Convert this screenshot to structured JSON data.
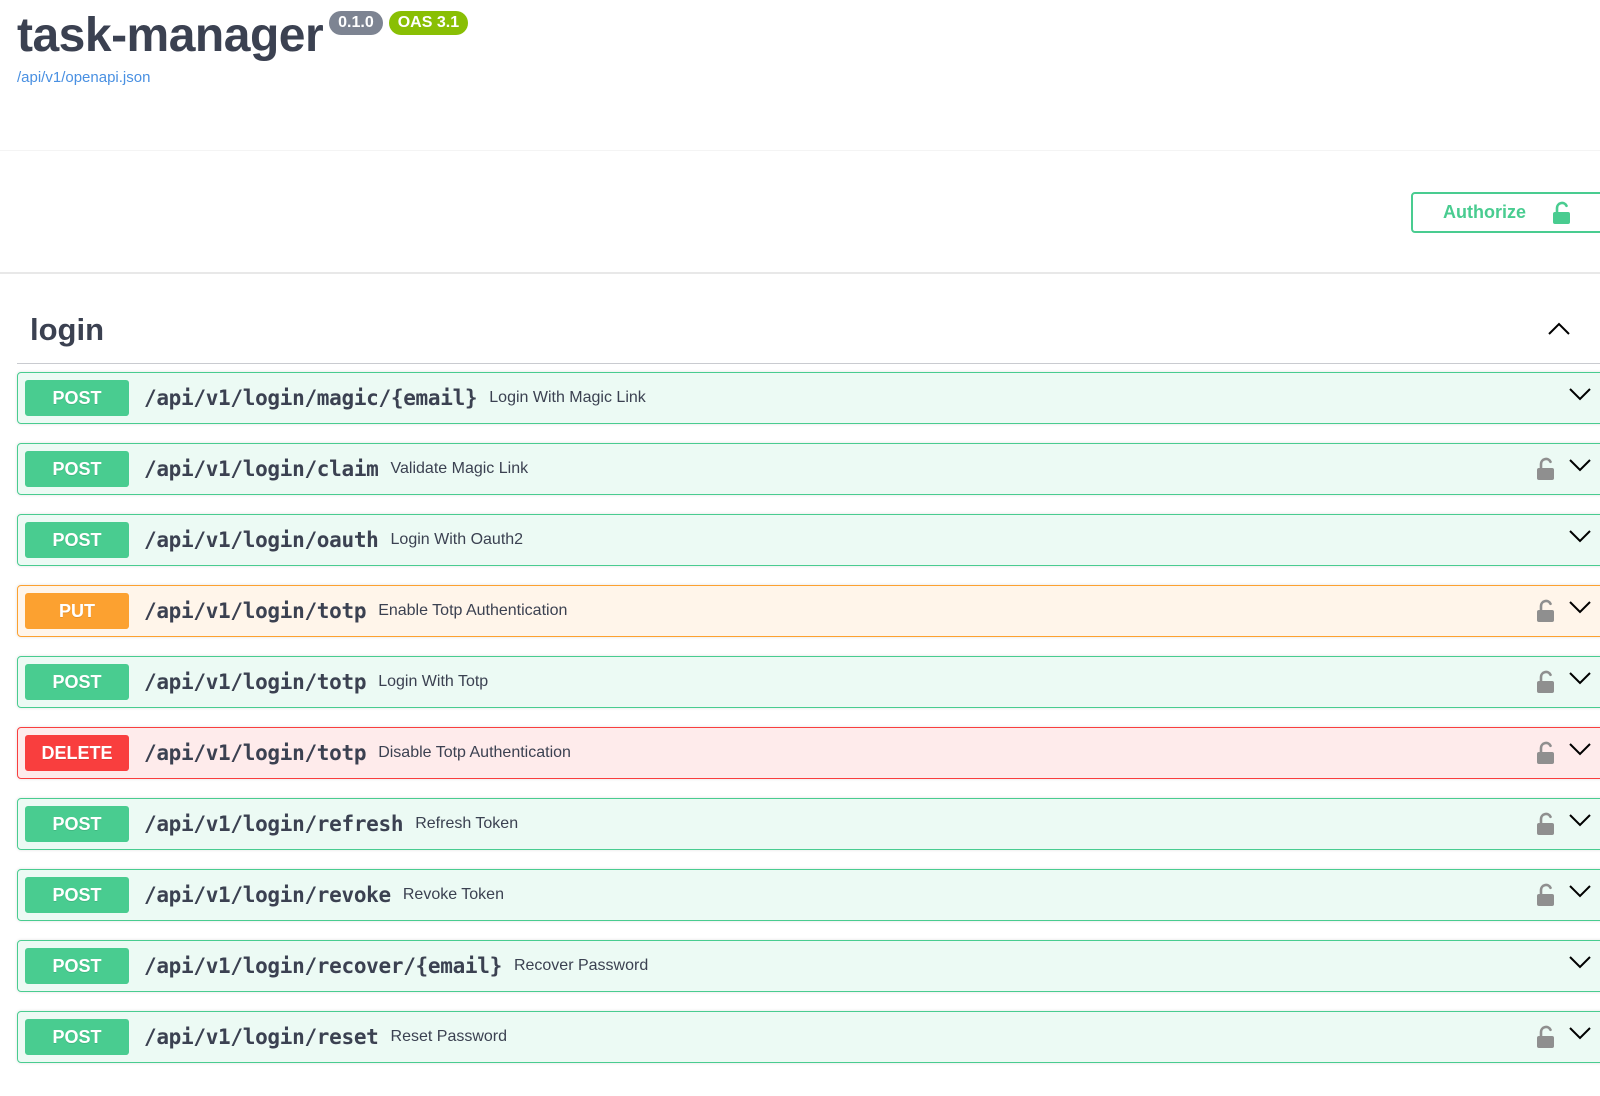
{
  "info": {
    "title": "task-manager",
    "version": "0.1.0",
    "oas": "OAS 3.1",
    "spec_url": "/api/v1/openapi.json"
  },
  "authorize": {
    "label": "Authorize"
  },
  "tag": {
    "name": "login",
    "expanded": true
  },
  "colors": {
    "post": "#49cc90",
    "put": "#fca130",
    "delete": "#f93e3e",
    "text": "#3b4151",
    "link": "#4990e2"
  },
  "operations": [
    {
      "method": "POST",
      "path": "/api/v1/login/magic/{email}",
      "summary": "Login With Magic Link",
      "locked": false
    },
    {
      "method": "POST",
      "path": "/api/v1/login/claim",
      "summary": "Validate Magic Link",
      "locked": true
    },
    {
      "method": "POST",
      "path": "/api/v1/login/oauth",
      "summary": "Login With Oauth2",
      "locked": false
    },
    {
      "method": "PUT",
      "path": "/api/v1/login/totp",
      "summary": "Enable Totp Authentication",
      "locked": true
    },
    {
      "method": "POST",
      "path": "/api/v1/login/totp",
      "summary": "Login With Totp",
      "locked": true
    },
    {
      "method": "DELETE",
      "path": "/api/v1/login/totp",
      "summary": "Disable Totp Authentication",
      "locked": true
    },
    {
      "method": "POST",
      "path": "/api/v1/login/refresh",
      "summary": "Refresh Token",
      "locked": true
    },
    {
      "method": "POST",
      "path": "/api/v1/login/revoke",
      "summary": "Revoke Token",
      "locked": true
    },
    {
      "method": "POST",
      "path": "/api/v1/login/recover/{email}",
      "summary": "Recover Password",
      "locked": false
    },
    {
      "method": "POST",
      "path": "/api/v1/login/reset",
      "summary": "Reset Password",
      "locked": true
    }
  ]
}
